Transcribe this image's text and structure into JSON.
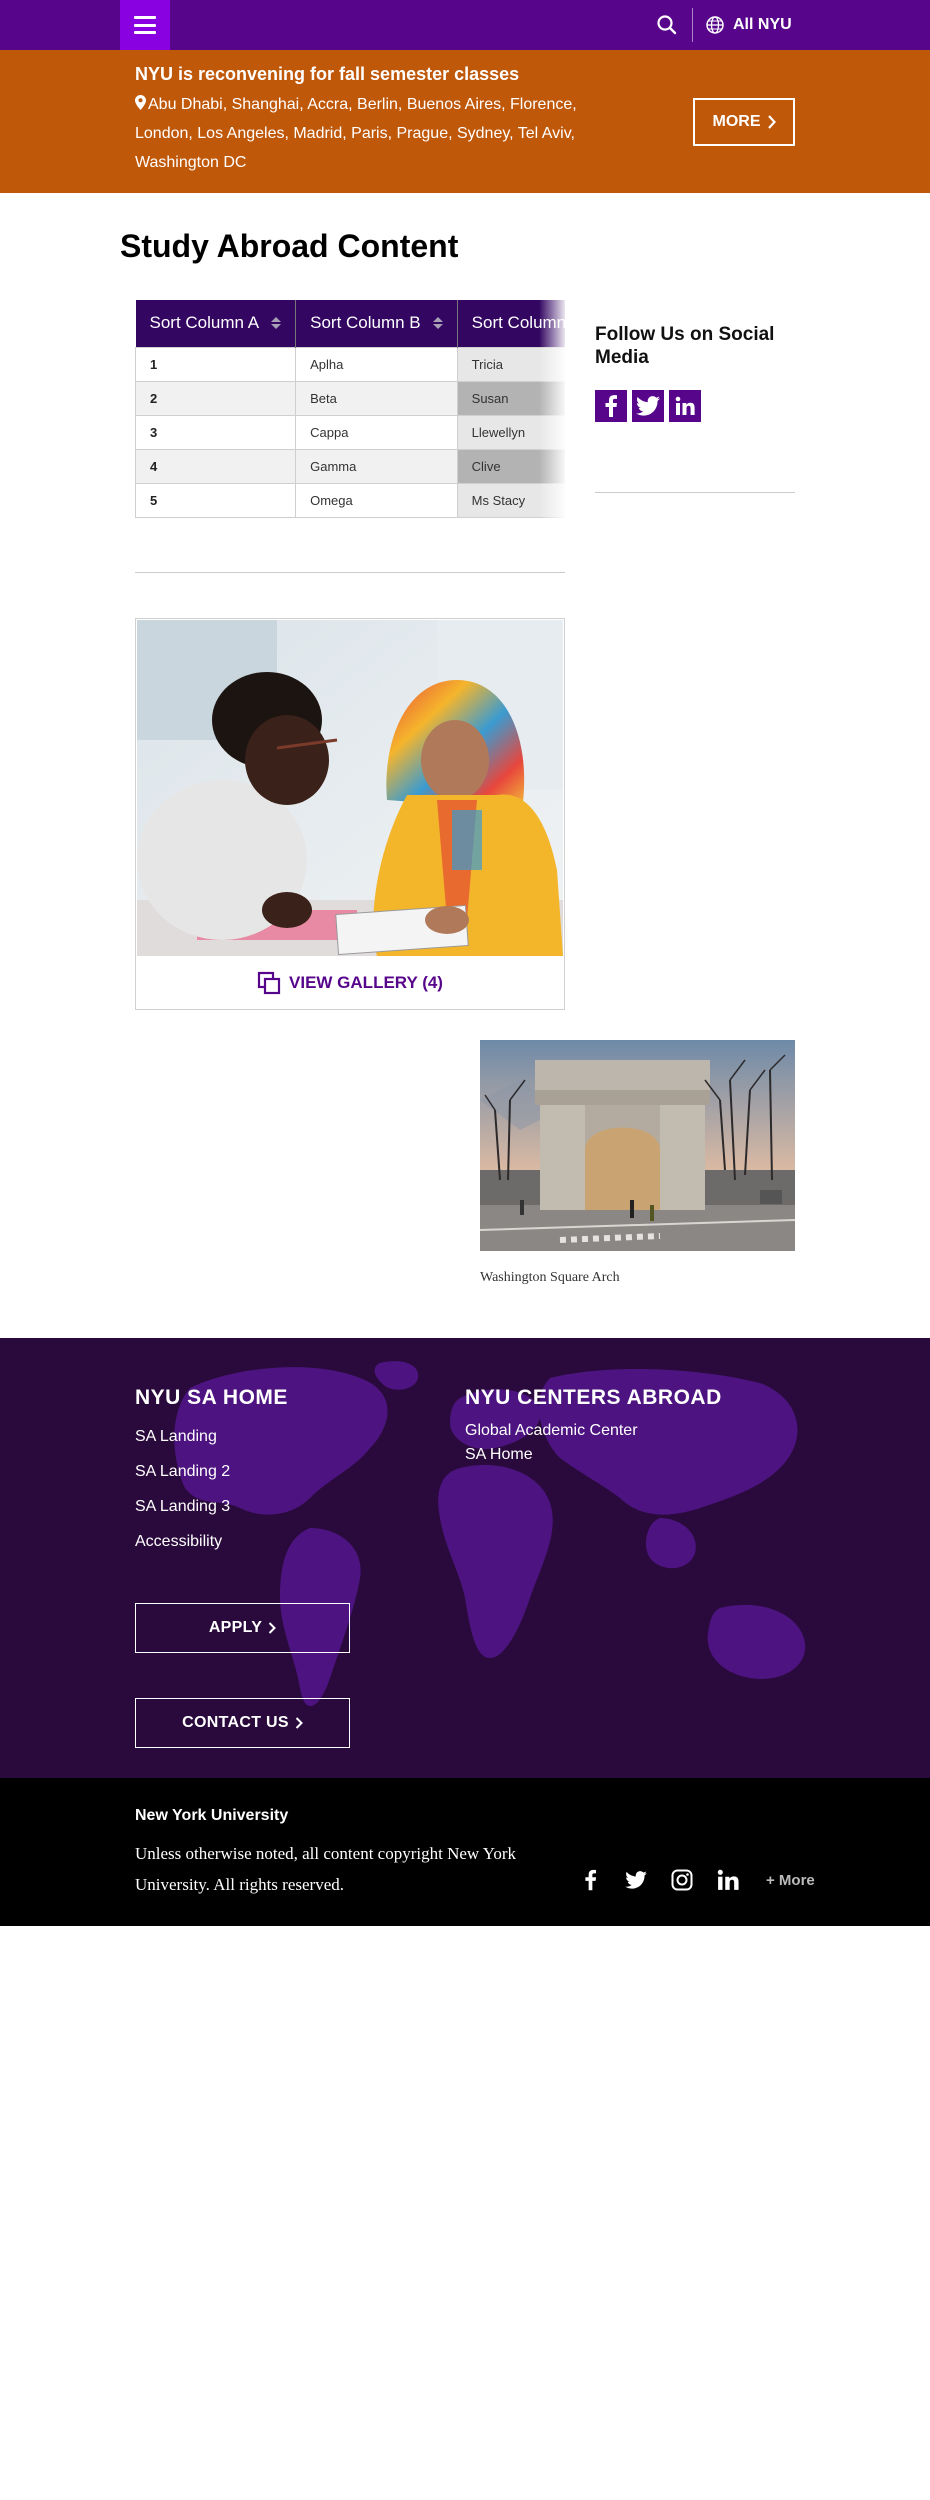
{
  "topbar": {
    "all_nyu_label": "All NYU",
    "colors": {
      "bar": "#57068c",
      "menu": "#8900e1"
    }
  },
  "alert": {
    "title": "NYU is reconvening for fall semester classes",
    "locations": "Abu Dhabi, Shanghai, Accra, Berlin, Buenos Aires, Florence, London, Los Angeles, Madrid, Paris, Prague, Sydney, Tel Aviv, Washington DC",
    "more_label": "MORE",
    "color": "#c0580a"
  },
  "page": {
    "title": "Study Abroad Content"
  },
  "table": {
    "headers": [
      "Sort Column A",
      "Sort Column B",
      "Sort Column C"
    ],
    "rows": [
      [
        "1",
        "Aplha",
        "Tricia"
      ],
      [
        "2",
        "Beta",
        "Susan"
      ],
      [
        "3",
        "Cappa",
        "Llewellyn"
      ],
      [
        "4",
        "Gamma",
        "Clive"
      ],
      [
        "5",
        "Omega",
        "Ms Stacy"
      ]
    ]
  },
  "social": {
    "title": "Follow Us on Social Media",
    "icons": [
      "facebook-icon",
      "twitter-icon",
      "linkedin-icon"
    ]
  },
  "gallery": {
    "link_label": "VIEW GALLERY (4)"
  },
  "arch": {
    "caption": "Washington Square Arch"
  },
  "footer": {
    "col1_title": "NYU SA HOME",
    "col1_links": [
      "SA Landing",
      "SA Landing 2",
      "SA Landing 3",
      "Accessibility"
    ],
    "col2_title": "NYU CENTERS ABROAD",
    "col2_links": [
      "Global Academic Center",
      "SA Home"
    ],
    "apply_label": "APPLY",
    "contact_label": "CONTACT US",
    "color": "#2a0a3c"
  },
  "bottom": {
    "title": "New York University",
    "copyright": "Unless otherwise noted, all content copyright New York University. All rights reserved.",
    "more_label": "+ More"
  }
}
